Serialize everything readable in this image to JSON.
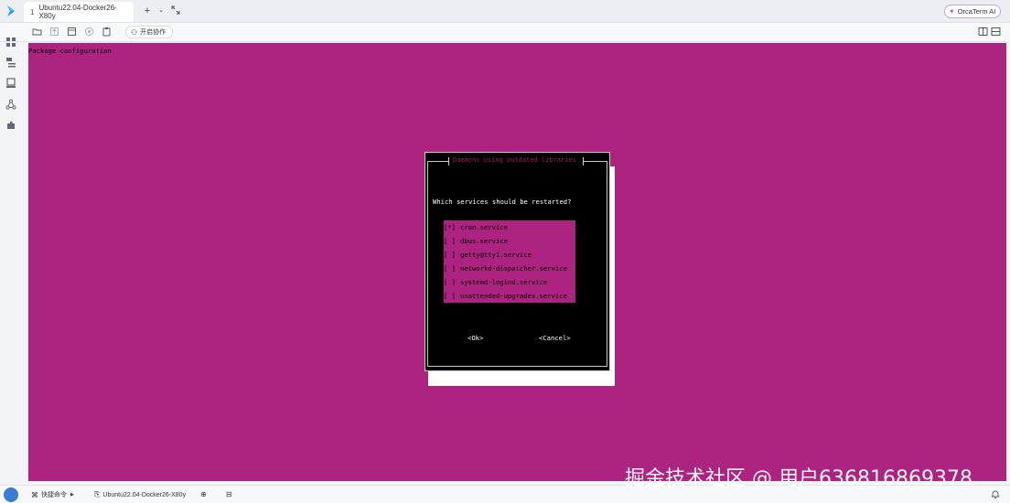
{
  "tabbar": {
    "tab_number": "1",
    "tab_title": "Ubuntu22.04-Docker26-X80y",
    "add_tab": "+",
    "tab_menu": "⌄",
    "ai_button": "OrcaTerm AI"
  },
  "toolbar": {
    "collab_label": "开启协作"
  },
  "terminal": {
    "header": "Package configuration",
    "dialog": {
      "title": "Daemons using outdated libraries",
      "question": "Which services should be restarted?",
      "items": [
        {
          "box": "[*]",
          "name": "cron.service"
        },
        {
          "box": "[ ]",
          "name": "dbus.service"
        },
        {
          "box": "[ ]",
          "name": "getty@tty1.service"
        },
        {
          "box": "[ ]",
          "name": "networkd-dispatcher.service"
        },
        {
          "box": "[ ]",
          "name": "systemd-logind.service"
        },
        {
          "box": "[ ]",
          "name": "unattended-upgrades.service"
        }
      ],
      "ok_label": "<Ok>",
      "cancel_label": "<Cancel>"
    }
  },
  "statusbar": {
    "quick_commands": "快捷命令",
    "session_name": "Ubuntu22.04-Docker26-X80y"
  },
  "watermark": "掘金技术社区 @ 用户636816869378",
  "colors": {
    "terminal_bg": "#ad2380",
    "dialog_bg": "#000000",
    "accent": "#b455d8"
  }
}
